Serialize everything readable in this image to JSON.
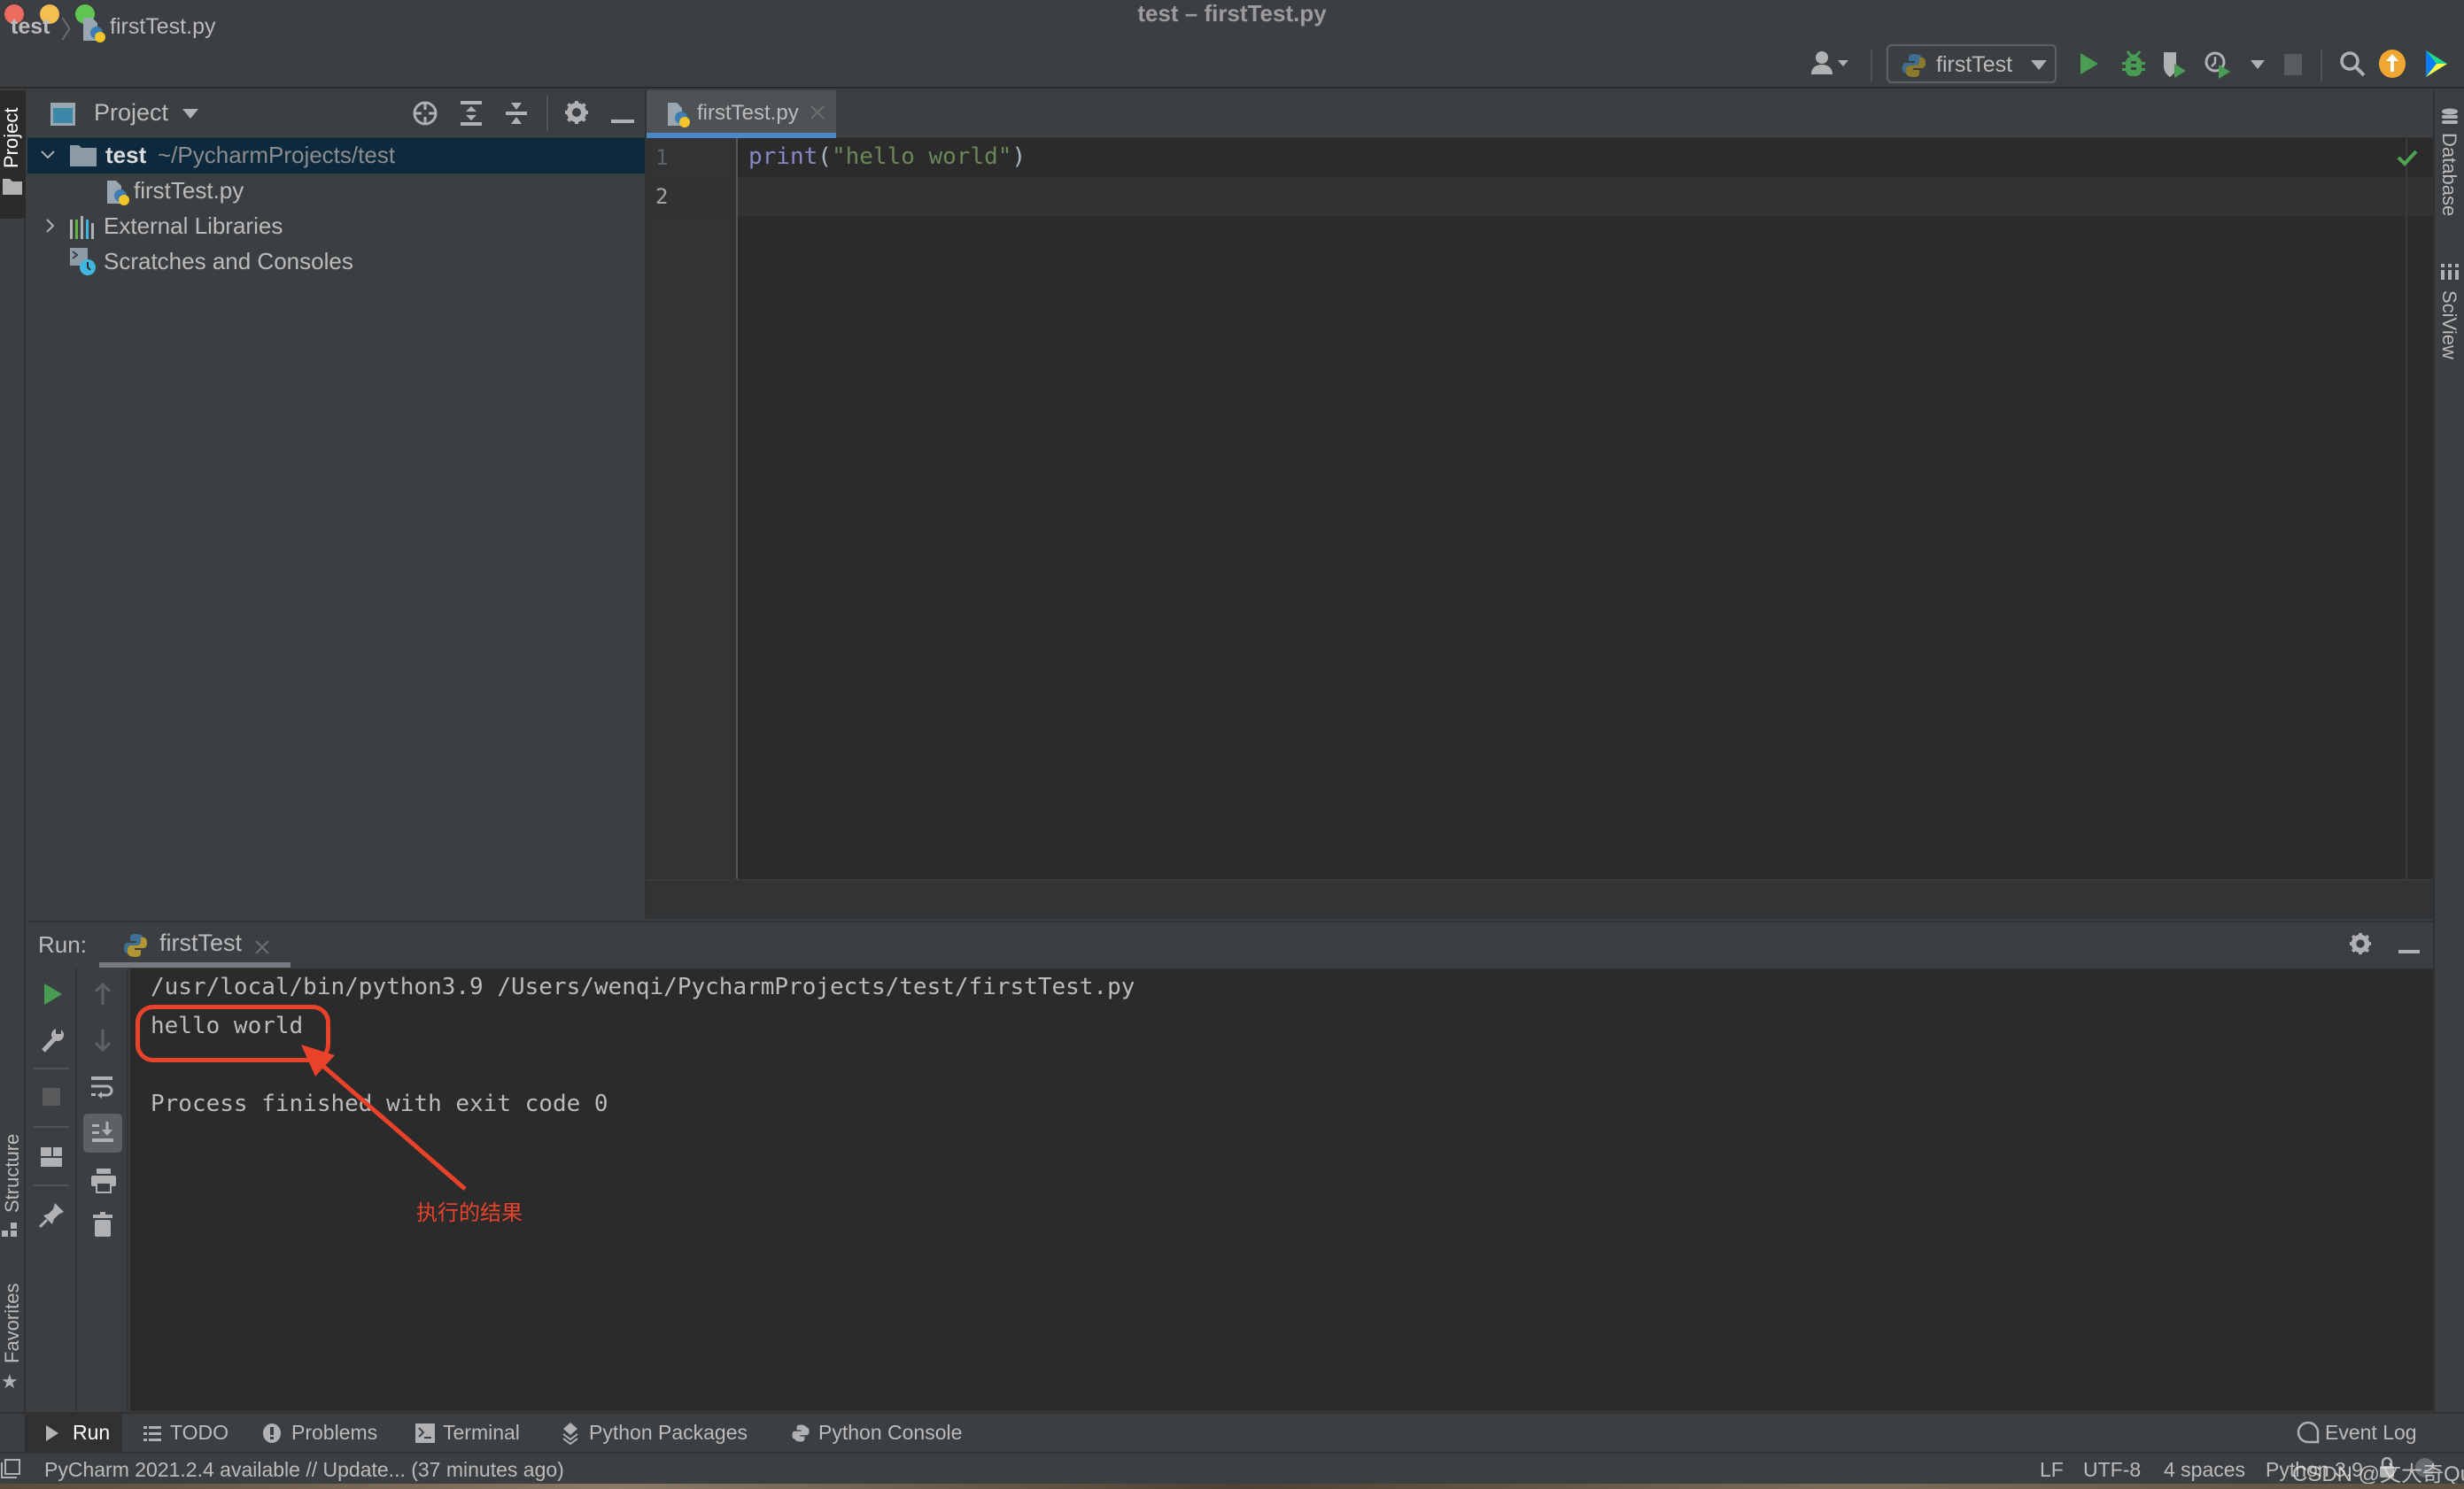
{
  "window": {
    "title": "test – firstTest.py",
    "traffic_lights": {
      "close": "#ed6a5e",
      "minimize": "#f5bf4f",
      "zoom": "#61c554"
    }
  },
  "toolbar": {
    "breadcrumb": {
      "project": "test",
      "file": "firstTest.py"
    },
    "run_config": "firstTest",
    "icons": [
      "user-icon",
      "run-icon",
      "debug-icon",
      "coverage-icon",
      "profile-icon",
      "stop-icon",
      "search-icon",
      "update-icon",
      "toolbox-icon"
    ]
  },
  "left_strip": {
    "project_label": "Project",
    "structure_label": "Structure",
    "favorites_label": "Favorites"
  },
  "right_strip": {
    "database_label": "Database",
    "sciview_label": "SciView"
  },
  "project_panel": {
    "title": "Project",
    "tree": [
      {
        "name": "test",
        "path": "~/PycharmProjects/test",
        "expanded": true,
        "selected": true
      },
      {
        "name": "firstTest.py"
      },
      {
        "name": "External Libraries",
        "expanded": false
      },
      {
        "name": "Scratches and Consoles"
      }
    ]
  },
  "editor": {
    "tab": "firstTest.py",
    "line_numbers": [
      "1",
      "2"
    ],
    "code": {
      "func": "print",
      "open": "(",
      "string": "\"hello world\"",
      "close": ")"
    },
    "inspection_status": "ok"
  },
  "run_panel": {
    "label": "Run:",
    "tab": "firstTest",
    "console": [
      "/usr/local/bin/python3.9 /Users/wenqi/PycharmProjects/test/firstTest.py",
      "hello world",
      "",
      "Process finished with exit code 0"
    ],
    "annotation": "执行的结果"
  },
  "bottom_tabs": [
    "Run",
    "TODO",
    "Problems",
    "Terminal",
    "Python Packages",
    "Python Console"
  ],
  "event_log": "Event Log",
  "status_bar": {
    "message": "PyCharm 2021.2.4 available // Update... (37 minutes ago)",
    "line_separator": "LF",
    "encoding": "UTF-8",
    "indent": "4 spaces",
    "interpreter": "Python 3.9"
  },
  "watermark": "CSDN @文大奇Quiin",
  "colors": {
    "accent": "#4a88c7",
    "run_green": "#499c54",
    "annotation_red": "#e8432a",
    "keyword": "#8888c6",
    "string": "#6a8759"
  }
}
